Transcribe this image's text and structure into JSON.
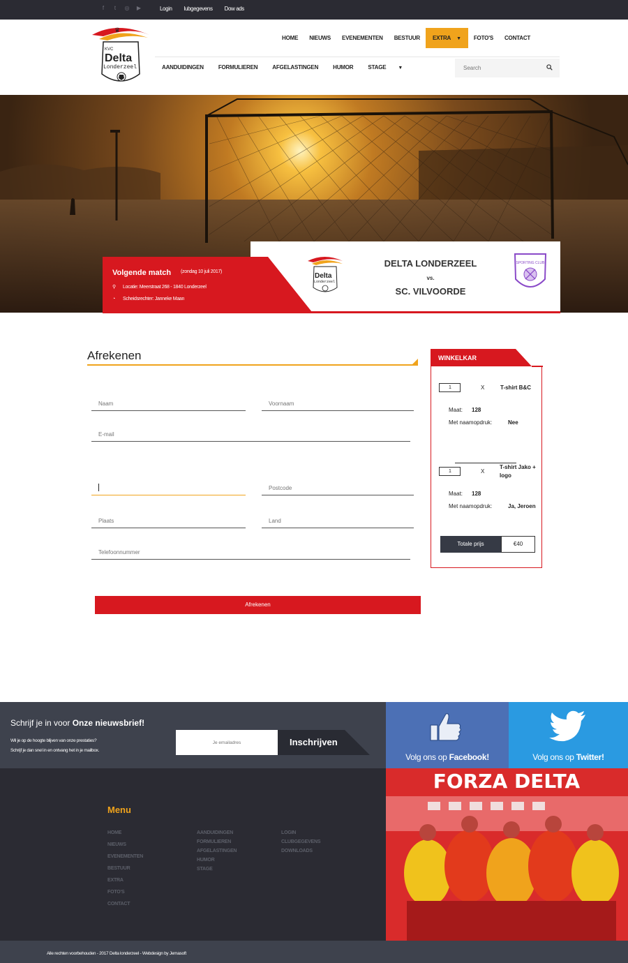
{
  "topbar": {
    "social_icons": [
      "facebook-icon",
      "twitter-icon",
      "instagram-icon",
      "youtube-icon"
    ],
    "links": [
      "Login",
      "lubgegevens",
      "Dow   ads"
    ]
  },
  "header": {
    "logo_text": {
      "top": "KVC",
      "main": "Delta",
      "sub": "Londerzeel"
    },
    "main_nav": [
      "HOME",
      "NIEUWS",
      "EVENEMENTEN",
      "BESTUUR",
      "EXTRA",
      "FOTO'S",
      "CONTACT"
    ],
    "active_main": "EXTRA",
    "sub_nav": [
      "AANDUIDINGEN",
      "FORMULIEREN",
      "AFGELASTINGEN",
      "HUMOR",
      "STAGE"
    ],
    "search_placeholder": "Search"
  },
  "match": {
    "title": "Volgende match",
    "date": "(zondag 10 juli 2017)",
    "location": "Locatie: Meerstraat 268 - 1840 Londerzeel",
    "referee": "Scheidsrechter: Janneke Maan",
    "home_team": "DELTA LONDERZEEL",
    "vs": "vs.",
    "away_team": "SC. VILVOORDE",
    "away_logo_text": "SPORTING CLUB"
  },
  "checkout": {
    "title": "Afrekenen",
    "fields": {
      "naam": "Naam",
      "voornaam": "Voornaam",
      "email": "E-mail",
      "adres": "",
      "postcode": "Postcode",
      "plaats": "Plaats",
      "land": "Land",
      "telefoon": "Telefoonnummer"
    },
    "button": "Afrekenen"
  },
  "cart": {
    "title": "WINKELKAR",
    "items": [
      {
        "qty": "1",
        "x": "X",
        "name": "T-shirt B&C",
        "maat_label": "Maat:",
        "maat": "128",
        "druk_label": "Met naamopdruk:",
        "druk": "Nee"
      },
      {
        "qty": "1",
        "x": "X",
        "name": "T-shirt Jako + logo",
        "maat_label": "Maat:",
        "maat": "128",
        "druk_label": "Met naamopdruk:",
        "druk": "Ja, Jeroen"
      }
    ],
    "total_label": "Totale prijs",
    "total_value": "€40"
  },
  "newsletter": {
    "title_pre": "Schrijf je in voor",
    "title_bold": "Onze nieuwsbrief!",
    "sub1": "Wil je op de hoogte blijven van onze prestaties?",
    "sub2": "Schrijf je dan snel in en ontvang het in je mailbox.",
    "placeholder": "Je emailadres",
    "button": "Inschrijven"
  },
  "social": {
    "facebook_pre": "Volg ons op",
    "facebook_bold": "Facebook!",
    "twitter_pre": "Volg ons op",
    "twitter_bold": "Twitter!"
  },
  "footer": {
    "menu_title": "Menu",
    "col1": [
      "HOME",
      "NIEUWS",
      "EVENEMENTEN",
      "BESTUUR",
      "EXTRA",
      "FOTO'S",
      "CONTACT"
    ],
    "col2": [
      "AANDUIDINGEN",
      "FORMULIEREN",
      "AFGELASTINGEN",
      "HUMOR",
      "STAGE"
    ],
    "col3": [
      "LOGIN",
      "CLUBGEGEVENS",
      "DOWNLOADS"
    ],
    "forza": "FORZA DELTA",
    "copyright": "Alle rechten voorbehouden - 2017 Delta londerzeel - Webdesign by Jemasoft"
  },
  "colors": {
    "accent": "#f0a31c",
    "red": "#d7181f",
    "dark": "#2b2b33",
    "facebook": "#4c70b5",
    "twitter": "#2a9ae1"
  }
}
